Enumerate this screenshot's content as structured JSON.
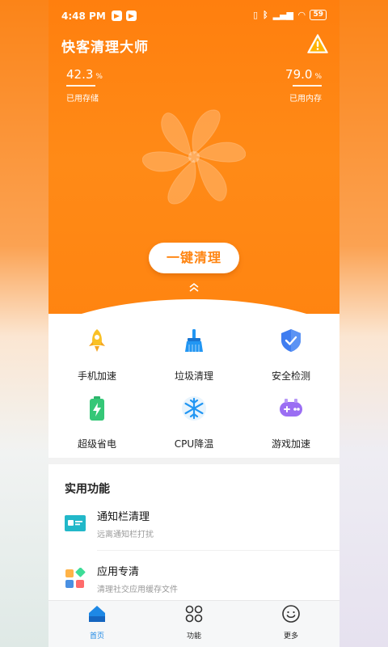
{
  "status_bar": {
    "time": "4:48 PM",
    "battery": "59"
  },
  "header": {
    "title": "快客清理大师"
  },
  "stats": {
    "storage": {
      "value": "42.3",
      "unit": "%",
      "label": "已用存储"
    },
    "memory": {
      "value": "79.0",
      "unit": "%",
      "label": "已用内存"
    }
  },
  "main": {
    "clean_button": "一键清理"
  },
  "grid": [
    {
      "label": "手机加速",
      "icon": "rocket-icon"
    },
    {
      "label": "垃圾清理",
      "icon": "broom-icon"
    },
    {
      "label": "安全检测",
      "icon": "shield-icon"
    },
    {
      "label": "超级省电",
      "icon": "battery-icon"
    },
    {
      "label": "CPU降温",
      "icon": "snowflake-icon"
    },
    {
      "label": "游戏加速",
      "icon": "gamepad-icon"
    }
  ],
  "utilities": {
    "title": "实用功能",
    "items": [
      {
        "name": "通知栏清理",
        "desc": "远离通知栏打扰",
        "icon": "notification-icon"
      },
      {
        "name": "应用专清",
        "desc": "清理社交应用缓存文件",
        "icon": "apps-icon"
      }
    ]
  },
  "bottom_nav": [
    {
      "label": "首页",
      "icon": "home-icon",
      "active": true
    },
    {
      "label": "功能",
      "icon": "grid-icon",
      "active": false
    },
    {
      "label": "更多",
      "icon": "smile-icon",
      "active": false
    }
  ],
  "colors": {
    "accent": "#ff8410",
    "active_tab": "#1e88e5"
  }
}
